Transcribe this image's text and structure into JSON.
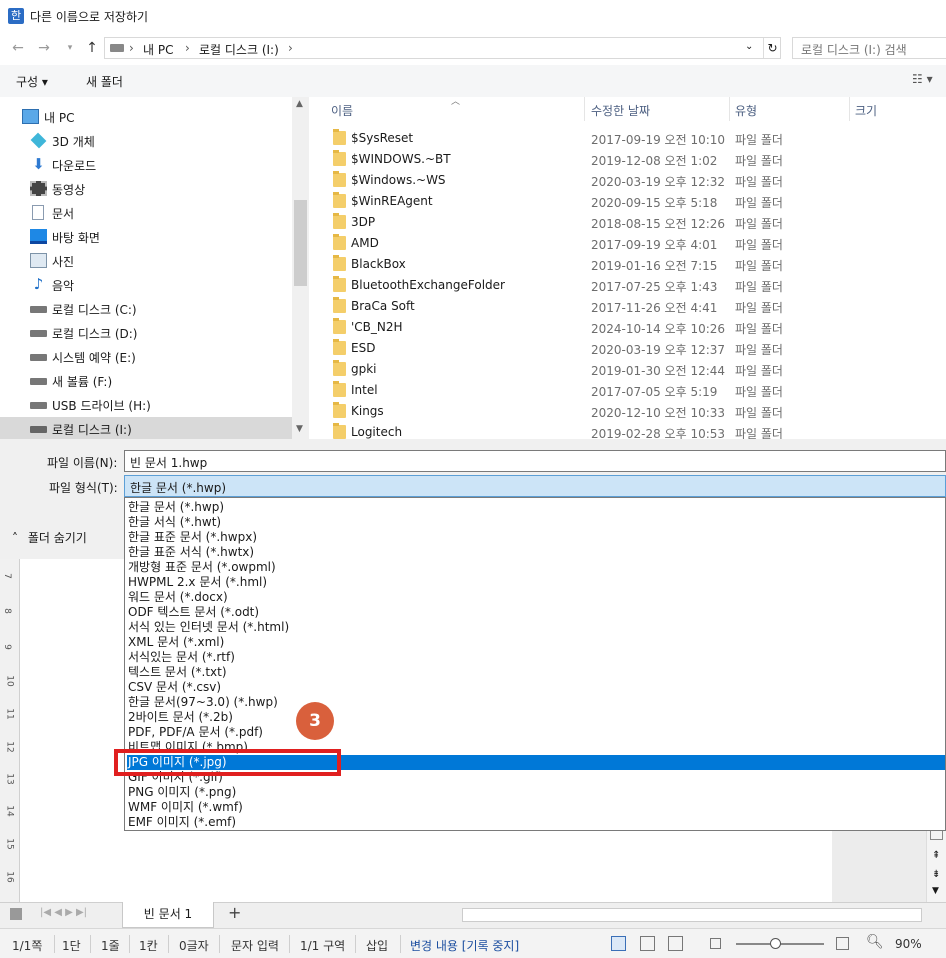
{
  "window": {
    "title": "다른 이름으로 저장하기",
    "app_icon_char": "한"
  },
  "address": {
    "path": [
      "내 PC",
      "로컬 디스크 (I:)"
    ],
    "search_placeholder": "로컬 디스크 (I:) 검색"
  },
  "toolbar": {
    "organize": "구성 ▾",
    "new_folder": "새 폴더"
  },
  "nav": {
    "items": [
      {
        "label": "내 PC",
        "icon": "pc-icon"
      },
      {
        "label": "3D 개체",
        "icon": "cube-icon"
      },
      {
        "label": "다운로드",
        "icon": "download-icon"
      },
      {
        "label": "동영상",
        "icon": "video-icon"
      },
      {
        "label": "문서",
        "icon": "document-icon"
      },
      {
        "label": "바탕 화면",
        "icon": "desktop-icon"
      },
      {
        "label": "사진",
        "icon": "picture-icon"
      },
      {
        "label": "음악",
        "icon": "music-icon"
      },
      {
        "label": "로컬 디스크 (C:)",
        "icon": "drive-icon"
      },
      {
        "label": "로컬 디스크 (D:)",
        "icon": "drive-icon"
      },
      {
        "label": "시스템 예약 (E:)",
        "icon": "drive-icon"
      },
      {
        "label": "새 볼륨 (F:)",
        "icon": "drive-icon"
      },
      {
        "label": "USB 드라이브 (H:)",
        "icon": "drive-icon"
      },
      {
        "label": "로컬 디스크 (I:)",
        "icon": "drive-icon",
        "selected": true
      }
    ]
  },
  "files": {
    "columns": {
      "name": "이름",
      "date": "수정한 날짜",
      "type": "유형",
      "size": "크기"
    },
    "rows": [
      {
        "name": "$SysReset",
        "date": "2017-09-19 오전 10:10",
        "type": "파일 폴더"
      },
      {
        "name": "$WINDOWS.~BT",
        "date": "2019-12-08 오전 1:02",
        "type": "파일 폴더"
      },
      {
        "name": "$Windows.~WS",
        "date": "2020-03-19 오후 12:32",
        "type": "파일 폴더"
      },
      {
        "name": "$WinREAgent",
        "date": "2020-09-15 오후 5:18",
        "type": "파일 폴더"
      },
      {
        "name": "3DP",
        "date": "2018-08-15 오전 12:26",
        "type": "파일 폴더"
      },
      {
        "name": "AMD",
        "date": "2017-09-19 오후 4:01",
        "type": "파일 폴더"
      },
      {
        "name": "BlackBox",
        "date": "2019-01-16 오전 7:15",
        "type": "파일 폴더"
      },
      {
        "name": "BluetoothExchangeFolder",
        "date": "2017-07-25 오후 1:43",
        "type": "파일 폴더"
      },
      {
        "name": "BraCa Soft",
        "date": "2017-11-26 오전 4:41",
        "type": "파일 폴더"
      },
      {
        "name": "'CB_N2H",
        "date": "2024-10-14 오후 10:26",
        "type": "파일 폴더"
      },
      {
        "name": "ESD",
        "date": "2020-03-19 오후 12:37",
        "type": "파일 폴더"
      },
      {
        "name": "gpki",
        "date": "2019-01-30 오전 12:44",
        "type": "파일 폴더"
      },
      {
        "name": "Intel",
        "date": "2017-07-05 오후 5:19",
        "type": "파일 폴더"
      },
      {
        "name": "Kings",
        "date": "2020-12-10 오전 10:33",
        "type": "파일 폴더"
      },
      {
        "name": "Logitech",
        "date": "2019-02-28 오후 10:53",
        "type": "파일 폴더"
      }
    ]
  },
  "form": {
    "filename_label": "파일 이름(N):",
    "filename_value": "빈 문서 1.hwp",
    "filetype_label": "파일 형식(T):",
    "filetype_value": "한글 문서 (*.hwp)",
    "hide_folders": "폴더 숨기기"
  },
  "filetype_options": [
    "한글 문서 (*.hwp)",
    "한글 서식 (*.hwt)",
    "한글 표준 문서 (*.hwpx)",
    "한글 표준 서식 (*.hwtx)",
    "개방형 표준 문서 (*.owpml)",
    "HWPML 2.x 문서 (*.hml)",
    "워드 문서 (*.docx)",
    "ODF 텍스트 문서 (*.odt)",
    "서식 있는 인터넷 문서 (*.html)",
    "XML 문서 (*.xml)",
    "서식있는 문서 (*.rtf)",
    "텍스트 문서 (*.txt)",
    "CSV 문서 (*.csv)",
    "한글 문서(97~3.0) (*.hwp)",
    "2바이트 문서 (*.2b)",
    "PDF, PDF/A 문서 (*.pdf)",
    "비트맵 이미지 (*.bmp)",
    "JPG 이미지 (*.jpg)",
    "GIF 이미지 (*.gif)",
    "PNG 이미지 (*.png)",
    "WMF 이미지 (*.wmf)",
    "EMF 이미지 (*.emf)"
  ],
  "selected_option_index": 17,
  "annotation": {
    "step": "3"
  },
  "ruler_numbers": [
    "7",
    "8",
    "9",
    "10",
    "11",
    "12",
    "13",
    "14",
    "15",
    "16"
  ],
  "doc_tab": {
    "label": "빈 문서 1",
    "add": "+"
  },
  "status": {
    "page": "1/1쪽",
    "column": "1단",
    "line": "1줄",
    "col": "1칸",
    "chars": "0글자",
    "mode": "문자 입력",
    "section": "1/1 구역",
    "insert": "삽입",
    "track": "변경 내용 [기록 중지]",
    "zoom": "90%"
  },
  "colors": {
    "selection": "#0078d7",
    "highlight": "#e01f1f",
    "marker": "#d9603c"
  }
}
